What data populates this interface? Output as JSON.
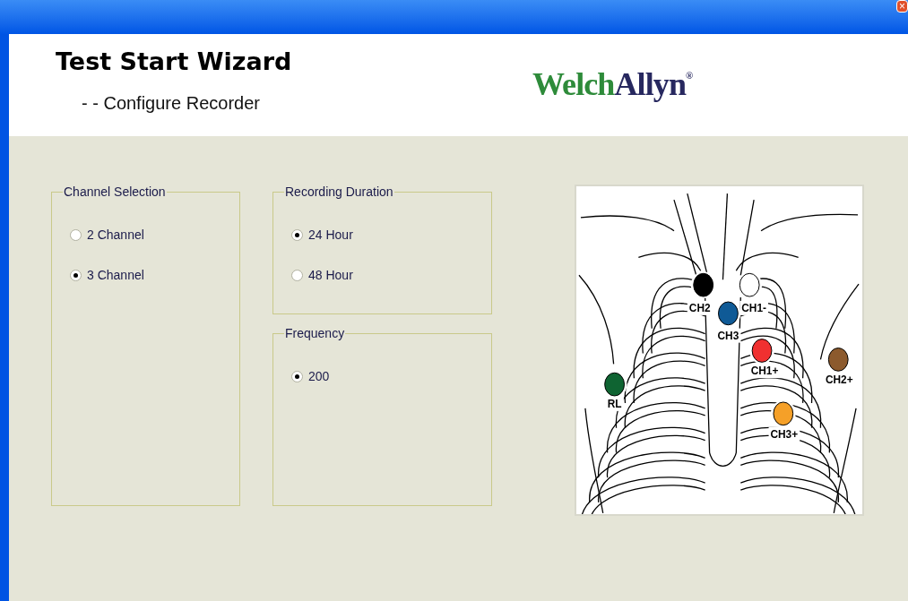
{
  "window": {
    "close": "×"
  },
  "header": {
    "title": "Test Start Wizard",
    "subtitle": "- - Configure Recorder",
    "logo": {
      "first": "Welch",
      "second": "Allyn",
      "mark": "®"
    }
  },
  "groups": [
    {
      "title": "Channel Selection",
      "options": [
        {
          "label": "2 Channel",
          "selected": false
        },
        {
          "label": "3 Channel",
          "selected": true
        }
      ]
    },
    {
      "title": "Recording Duration",
      "options": [
        {
          "label": "24 Hour",
          "selected": true
        },
        {
          "label": "48 Hour",
          "selected": false
        }
      ]
    },
    {
      "title": "Frequency",
      "options": [
        {
          "label": "200",
          "selected": true
        }
      ]
    }
  ],
  "electrodes": [
    {
      "label": "CH2",
      "color": "#000000"
    },
    {
      "label": "CH1-",
      "color": "#ffffff"
    },
    {
      "label": "CH3",
      "color": "#0f5a96"
    },
    {
      "label": "CH1+",
      "color": "#f03030"
    },
    {
      "label": "CH2+",
      "color": "#8c5a2d"
    },
    {
      "label": "RL",
      "color": "#0f6432"
    },
    {
      "label": "CH3+",
      "color": "#f5a028"
    }
  ]
}
